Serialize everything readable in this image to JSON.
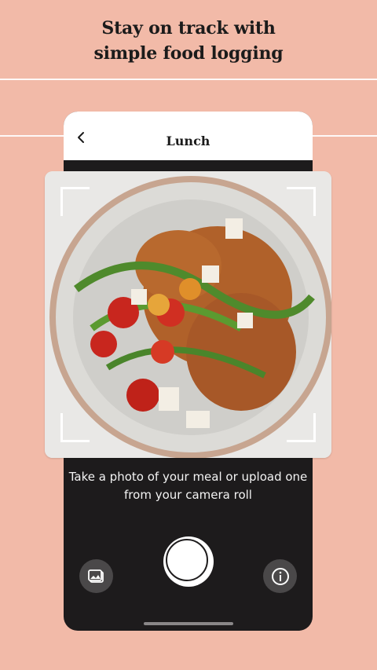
{
  "marketing": {
    "headline_line1": "Stay on track with",
    "headline_line2": "simple food logging"
  },
  "header": {
    "title": "Lunch",
    "back_icon": "chevron-left-icon"
  },
  "camera": {
    "instructions_line1": "Take a photo of your meal or upload one",
    "instructions_line2": "from your camera roll",
    "gallery_icon": "gallery-icon",
    "info_icon": "info-icon",
    "shutter_icon": "shutter-button"
  },
  "colors": {
    "background": "#f2baa8",
    "phone": "#1d1b1c",
    "accent_white": "#ffffff"
  }
}
